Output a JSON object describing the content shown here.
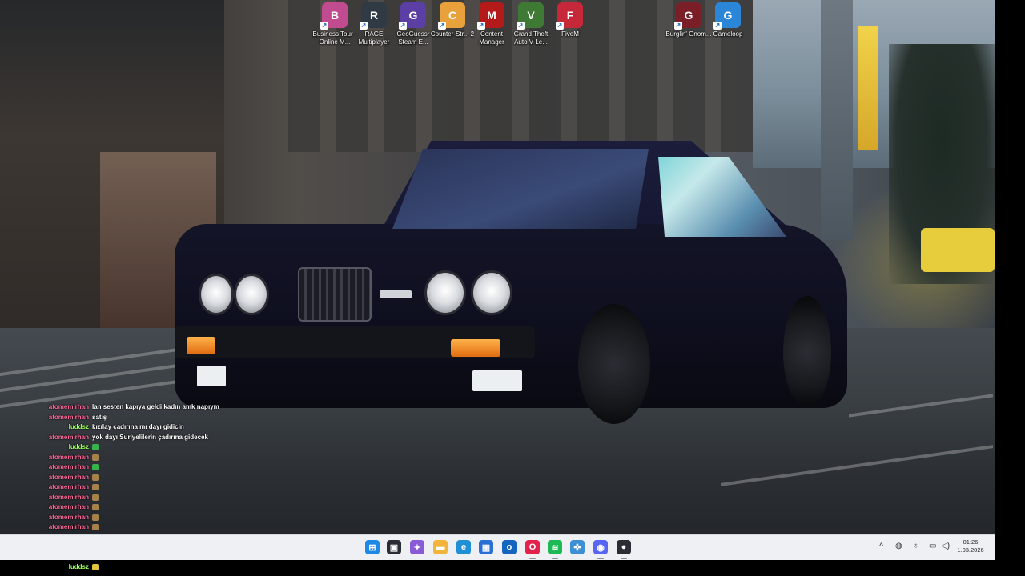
{
  "desktop": {
    "icons": [
      {
        "name": "business-tour-icon",
        "label": "Business Tour - Online M...",
        "color": "#c04b8f",
        "glyph": "B"
      },
      {
        "name": "rage-multiplayer-icon",
        "label": "RAGE Multiplayer",
        "color": "#2f3a44",
        "glyph": "R"
      },
      {
        "name": "geoguessr-icon",
        "label": "GeoGuessr Steam E...",
        "color": "#5b3fa4",
        "glyph": "G"
      },
      {
        "name": "counter-strike-2-icon",
        "label": "Counter-Str... 2",
        "color": "#e9a23b",
        "glyph": "C"
      },
      {
        "name": "content-manager-icon",
        "label": "Content Manager",
        "color": "#b51a1a",
        "glyph": "M"
      },
      {
        "name": "gta-v-icon",
        "label": "Grand Theft Auto V Le...",
        "color": "#3f7a34",
        "glyph": "V"
      },
      {
        "name": "fivem-icon",
        "label": "FiveM",
        "color": "#c6283a",
        "glyph": "F"
      },
      {
        "name": "burglin-gnomes-icon",
        "label": "Burglin' Gnom...",
        "color": "#7a1f28",
        "glyph": "G"
      },
      {
        "name": "gameloop-icon",
        "label": "Gameloop",
        "color": "#2b86d8",
        "glyph": "G"
      }
    ]
  },
  "chat": {
    "messages": [
      {
        "user": "atomemirhan",
        "text": "lan sesten kapıya geldi kadın amk napıym",
        "user_color": "#ff6b9a",
        "emote": ""
      },
      {
        "user": "atomemirhan",
        "text": "satış",
        "user_color": "#ff6b9a",
        "emote": ""
      },
      {
        "user": "luddsz",
        "text": "kızılay çadırına mı dayı gidicin",
        "user_color": "#9bff5c",
        "emote": ""
      },
      {
        "user": "atomemirhan",
        "text": "yok dayı Suriyelilerin çadırına gidecek",
        "user_color": "#ff6b9a",
        "emote": ""
      },
      {
        "user": "luddsz",
        "text": "",
        "user_color": "#9bff5c",
        "emote": "#37b24d"
      },
      {
        "user": "atomemirhan",
        "text": "",
        "user_color": "#ff6b9a",
        "emote": "#a6824a"
      },
      {
        "user": "atomemirhan",
        "text": "",
        "user_color": "#ff6b9a",
        "emote": "#37b24d"
      },
      {
        "user": "atomemirhan",
        "text": "",
        "user_color": "#ff6b9a",
        "emote": "#a6824a"
      },
      {
        "user": "atomemirhan",
        "text": "",
        "user_color": "#ff6b9a",
        "emote": "#a6824a"
      },
      {
        "user": "atomemirhan",
        "text": "",
        "user_color": "#ff6b9a",
        "emote": "#a6824a"
      },
      {
        "user": "atomemirhan",
        "text": "",
        "user_color": "#ff6b9a",
        "emote": "#a6824a"
      },
      {
        "user": "atomemirhan",
        "text": "",
        "user_color": "#ff6b9a",
        "emote": "#a6824a"
      },
      {
        "user": "atomemirhan",
        "text": "",
        "user_color": "#ff6b9a",
        "emote": "#a6824a"
      },
      {
        "user": "atomemirhan",
        "text": "",
        "user_color": "#ff6b9a",
        "emote": "#a6824a"
      },
      {
        "user": "atomemirhan",
        "text": "",
        "user_color": "#ff6b9a",
        "emote": "#a6824a"
      },
      {
        "user": "atomemirhan",
        "text": "",
        "user_color": "#ff6b9a",
        "emote": ""
      },
      {
        "user": "luddsz",
        "text": "",
        "user_color": "#9bff5c",
        "emote": "#e2c43a"
      }
    ]
  },
  "taskbar": {
    "apps": [
      {
        "name": "start-button-icon",
        "glyph": "⊞",
        "color": "#1e88e5"
      },
      {
        "name": "task-view-icon",
        "glyph": "▣",
        "color": "#2a2d33"
      },
      {
        "name": "copilot-icon",
        "glyph": "✦",
        "color": "#8a5bd6"
      },
      {
        "name": "file-explorer-icon",
        "glyph": "▬",
        "color": "#f2b43a"
      },
      {
        "name": "edge-browser-icon",
        "glyph": "e",
        "color": "#1f8fd6"
      },
      {
        "name": "microsoft-store-icon",
        "glyph": "▦",
        "color": "#2a6fd6"
      },
      {
        "name": "outlook-icon",
        "glyph": "o",
        "color": "#1565c0"
      },
      {
        "name": "opera-gx-icon",
        "glyph": "O",
        "color": "#e2224a"
      },
      {
        "name": "spotify-icon",
        "glyph": "≋",
        "color": "#1db954"
      },
      {
        "name": "network-app-icon",
        "glyph": "✜",
        "color": "#3d8fd6"
      },
      {
        "name": "discord-icon",
        "glyph": "◉",
        "color": "#5865f2"
      },
      {
        "name": "recording-app-icon",
        "glyph": "●",
        "color": "#2a2d33"
      }
    ],
    "tray": {
      "chevron": "^",
      "clock_time": "01:26",
      "clock_date": "1.03.2026"
    }
  }
}
